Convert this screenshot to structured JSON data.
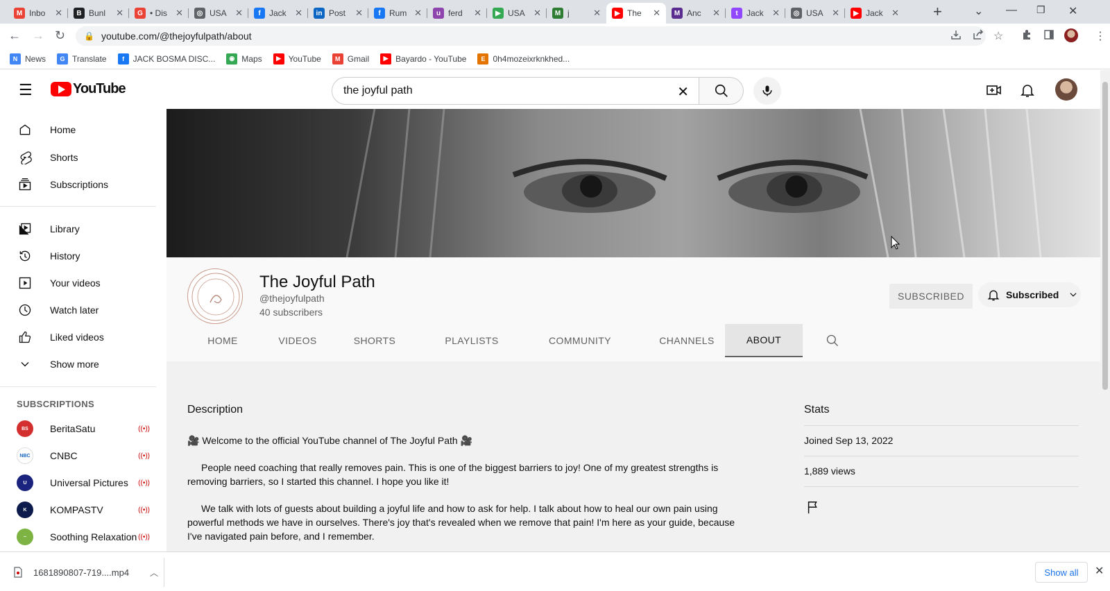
{
  "browser": {
    "tabs": [
      {
        "label": "Inbo",
        "color": "#ea4335",
        "glyph": "M"
      },
      {
        "label": "Bunl",
        "color": "#202124",
        "glyph": "B"
      },
      {
        "label": "• Dis",
        "color": "#ea4335",
        "glyph": "G"
      },
      {
        "label": "USA",
        "color": "#5f6368",
        "glyph": "◎"
      },
      {
        "label": "Jack",
        "color": "#1877f2",
        "glyph": "f"
      },
      {
        "label": "Post",
        "color": "#0a66c2",
        "glyph": "in"
      },
      {
        "label": "Rum",
        "color": "#1877f2",
        "glyph": "f"
      },
      {
        "label": "ferd",
        "color": "#8e44ad",
        "glyph": "u"
      },
      {
        "label": "USA",
        "color": "#34a853",
        "glyph": "▶"
      },
      {
        "label": "j",
        "color": "#2e7d32",
        "glyph": "M"
      },
      {
        "label": "The",
        "color": "#ff0000",
        "glyph": "▶"
      },
      {
        "label": "Anc",
        "color": "#5b2c8f",
        "glyph": "M"
      },
      {
        "label": "Jack",
        "color": "#9146ff",
        "glyph": "t"
      },
      {
        "label": "USA",
        "color": "#5f6368",
        "glyph": "◎"
      },
      {
        "label": "Jack",
        "color": "#ff0000",
        "glyph": "▶"
      }
    ],
    "url": "youtube.com/@thejoyfulpath/about",
    "bookmarks": [
      {
        "label": "News",
        "color": "#4285f4",
        "glyph": "N"
      },
      {
        "label": "Translate",
        "color": "#4285f4",
        "glyph": "G"
      },
      {
        "label": "JACK BOSMA DISC...",
        "color": "#1877f2",
        "glyph": "f"
      },
      {
        "label": "Maps",
        "color": "#34a853",
        "glyph": "◉"
      },
      {
        "label": "YouTube",
        "color": "#ff0000",
        "glyph": "▶"
      },
      {
        "label": "Gmail",
        "color": "#ea4335",
        "glyph": "M"
      },
      {
        "label": "Bayardo - YouTube",
        "color": "#ff0000",
        "glyph": "▶"
      },
      {
        "label": "0h4mozeixrknkhed...",
        "color": "#e37400",
        "glyph": "E"
      }
    ]
  },
  "youtube": {
    "logo_text": "YouTube",
    "search_value": "the joyful path",
    "sidebar": {
      "main": [
        {
          "label": "Home",
          "icon": "home-icon"
        },
        {
          "label": "Shorts",
          "icon": "shorts-icon"
        },
        {
          "label": "Subscriptions",
          "icon": "subscriptions-icon"
        }
      ],
      "library": [
        {
          "label": "Library",
          "icon": "library-icon"
        },
        {
          "label": "History",
          "icon": "history-icon"
        },
        {
          "label": "Your videos",
          "icon": "your-videos-icon"
        },
        {
          "label": "Watch later",
          "icon": "watch-later-icon"
        },
        {
          "label": "Liked videos",
          "icon": "liked-videos-icon"
        },
        {
          "label": "Show more",
          "icon": "chevron-down-icon"
        }
      ],
      "subscriptions_header": "SUBSCRIPTIONS",
      "subscriptions": [
        {
          "label": "BeritaSatu",
          "color": "#d32f2f"
        },
        {
          "label": "CNBC",
          "color": "#ffffff"
        },
        {
          "label": "Universal Pictures",
          "color": "#1a237e"
        },
        {
          "label": "KOMPASTV",
          "color": "#0d1b4c"
        },
        {
          "label": "Soothing Relaxation",
          "color": "#7cb342"
        }
      ]
    },
    "channel": {
      "name": "The Joyful Path",
      "handle": "@thejoyfulpath",
      "subscribers": "40 subscribers",
      "subscribed_label": "SUBSCRIBED",
      "subscribed_dropdown_label": "Subscribed",
      "tabs": [
        "HOME",
        "VIDEOS",
        "SHORTS",
        "PLAYLISTS",
        "COMMUNITY",
        "CHANNELS",
        "ABOUT"
      ],
      "active_tab": "ABOUT"
    },
    "about": {
      "description_header": "Description",
      "paragraphs": [
        "Welcome to the official YouTube channel of The Joyful Path",
        "People need coaching that really removes pain. This is one of the biggest barriers to joy! One of my greatest strengths is removing barriers, so I started this channel. I hope you like it!",
        "We talk with lots of guests about building a joyful life and how to ask for help. I talk about how to heal our own pain using powerful methods we have in ourselves. There's joy that's revealed when we remove that pain! I'm here as your guide, because I've navigated pain before, and I remember."
      ],
      "stats_header": "Stats",
      "joined": "Joined Sep 13, 2022",
      "views": "1,889 views"
    }
  },
  "download": {
    "filename": "1681890807-719....mp4",
    "show_all": "Show all"
  }
}
